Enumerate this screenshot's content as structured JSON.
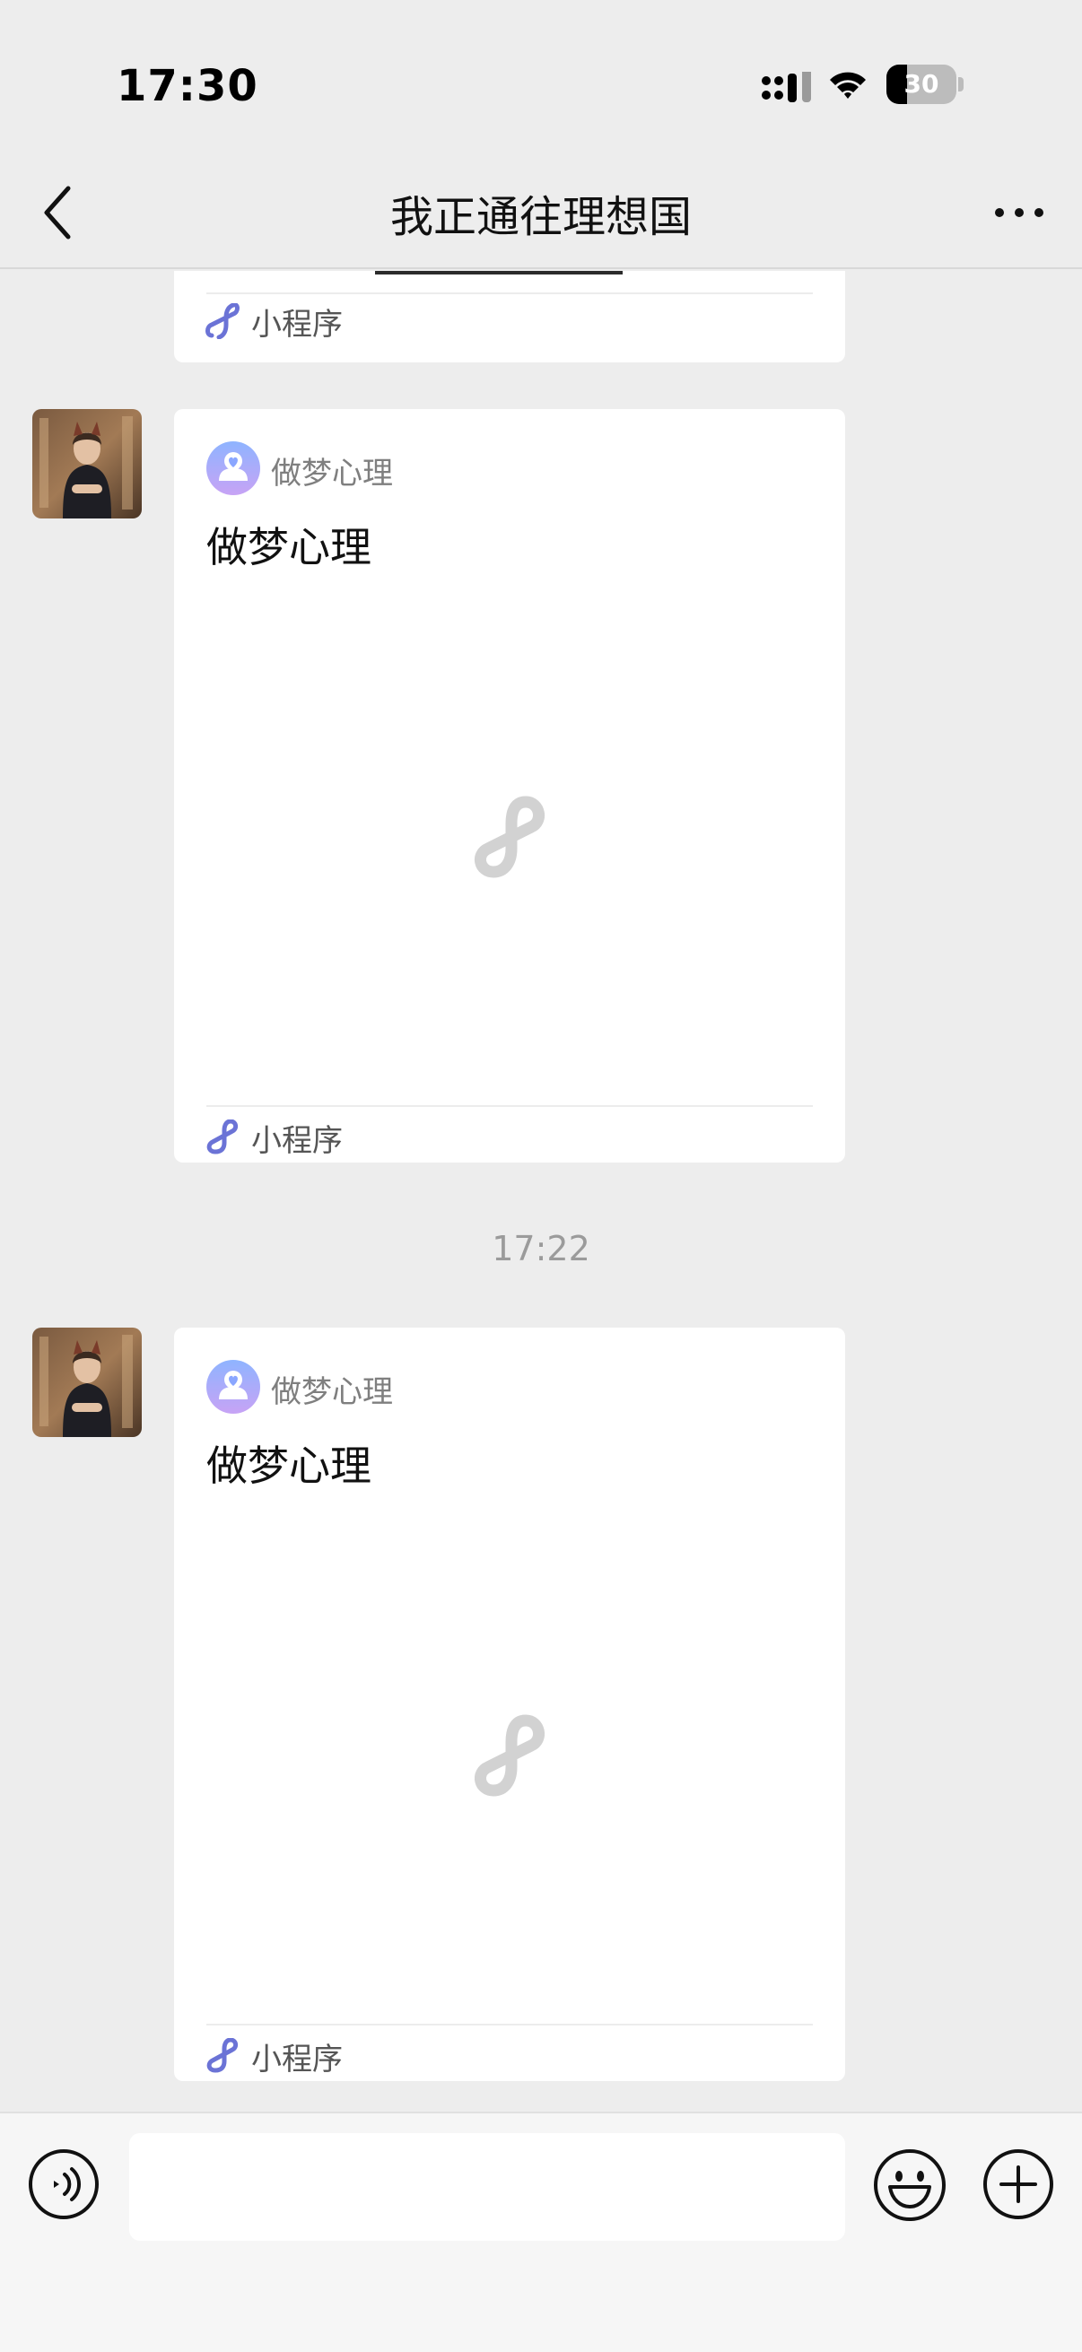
{
  "status_bar": {
    "time": "17:30",
    "battery_level": "30",
    "battery_fraction": 0.3,
    "icons": [
      "signal-icon",
      "wifi-icon",
      "battery-icon"
    ]
  },
  "nav": {
    "title": "我正通往理想国",
    "back_icon": "chevron-left-icon",
    "more_icon": "more-dots-icon"
  },
  "messages": [
    {
      "type": "mini-program-card-partial",
      "footer_label": "小程序"
    },
    {
      "type": "mini-program-card",
      "app_name": "做梦心理",
      "title": "做梦心理",
      "footer_label": "小程序"
    },
    {
      "type": "timestamp",
      "text": "17:22"
    },
    {
      "type": "mini-program-card",
      "app_name": "做梦心理",
      "title": "做梦心理",
      "footer_label": "小程序"
    }
  ],
  "input_bar": {
    "input_value": "",
    "icons": [
      "voice-icon",
      "emoji-icon",
      "plus-icon"
    ]
  },
  "colors": {
    "background": "#ededed",
    "card": "#ffffff",
    "mini_program_accent": "#6b73d6",
    "timestamp": "#9b9b9b"
  }
}
